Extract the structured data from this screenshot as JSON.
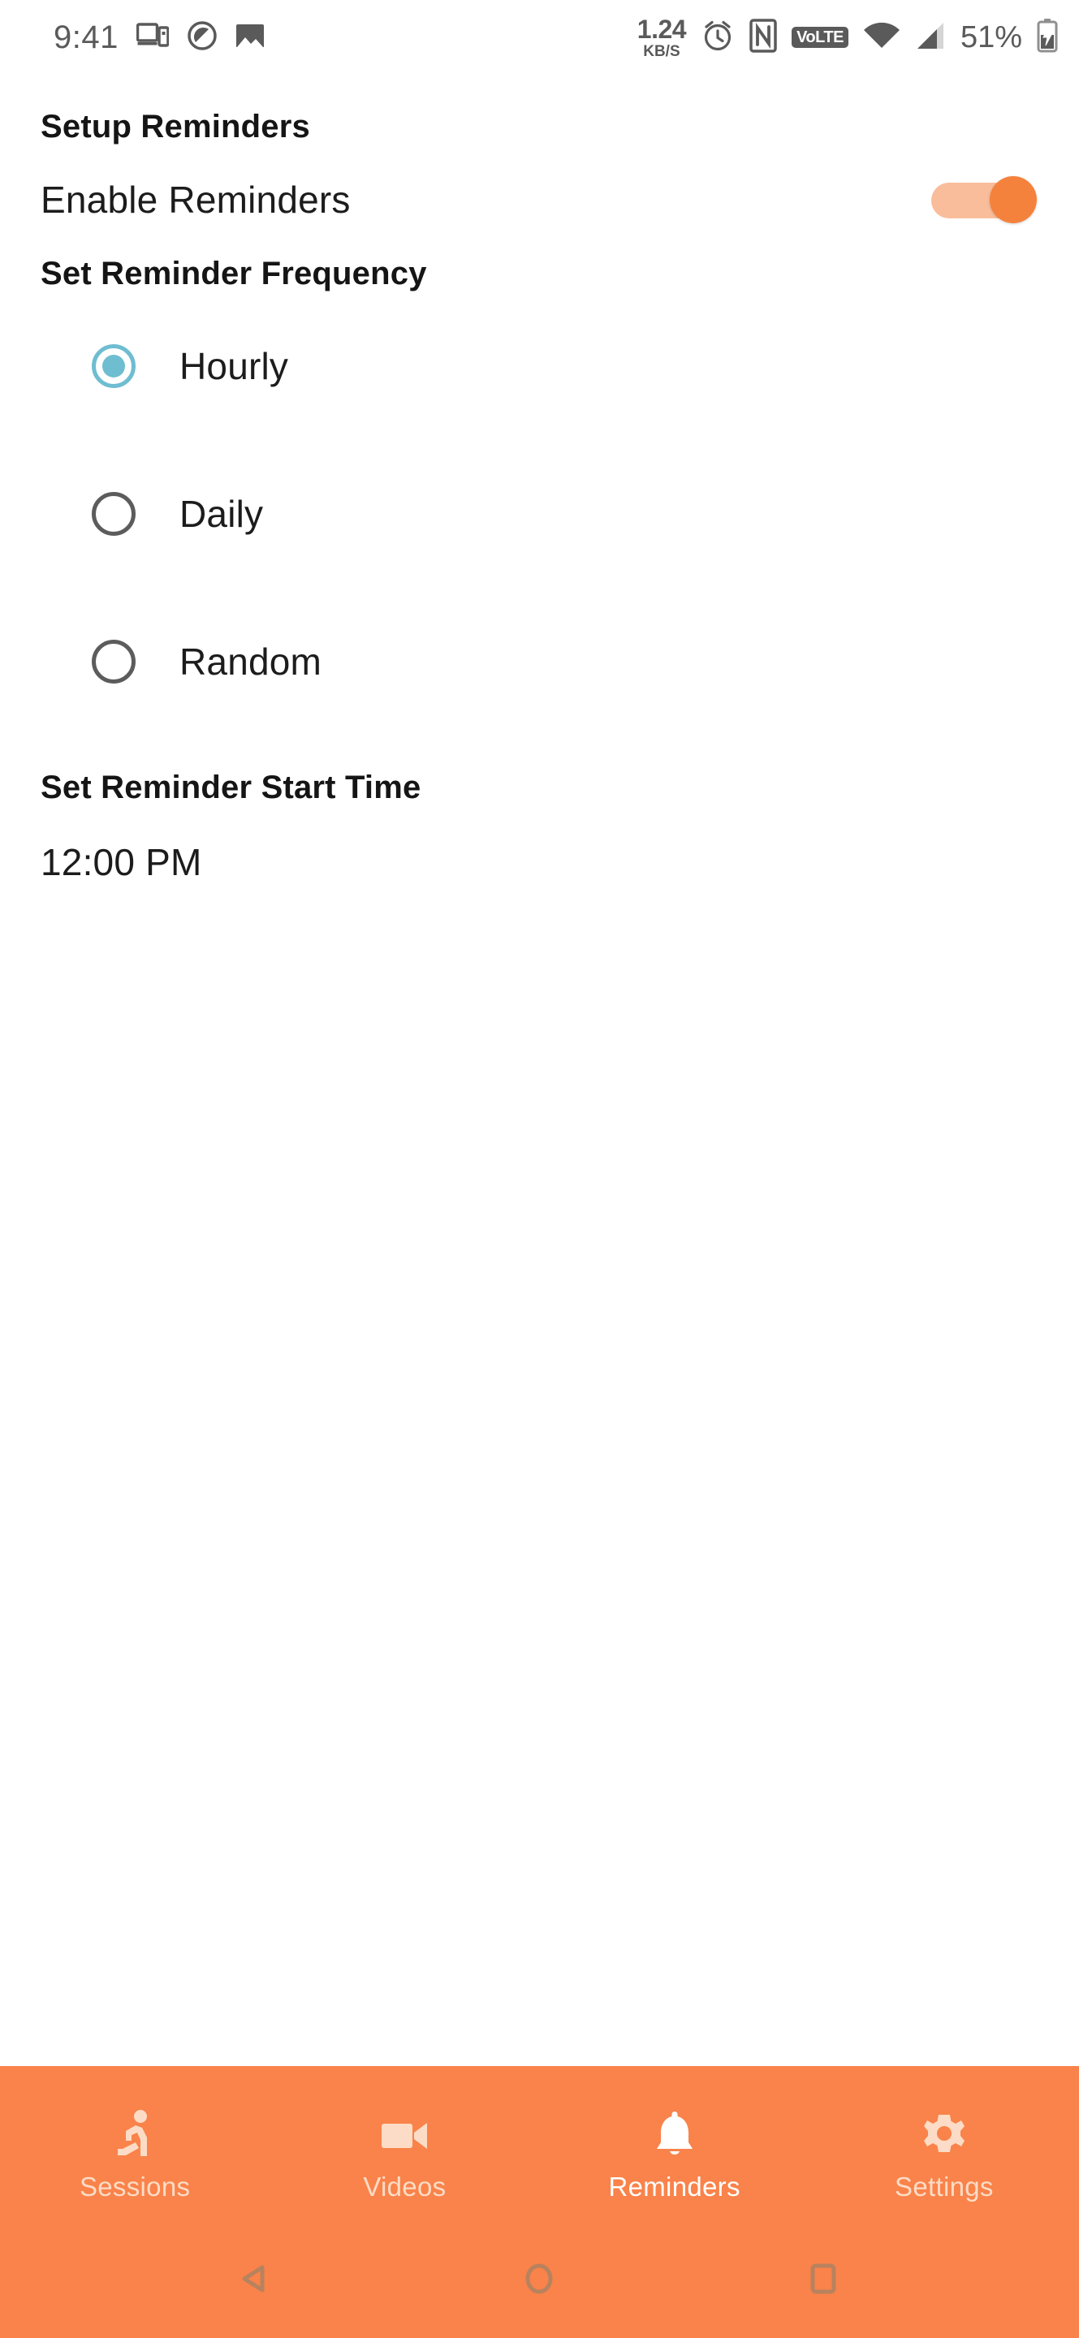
{
  "status_bar": {
    "clock": "9:41",
    "left_icons": [
      "cast-screen-icon",
      "privacy-shield-icon",
      "image-icon"
    ],
    "network_speed_value": "1.24",
    "network_speed_unit": "KB/S",
    "right_icons": [
      "alarm-clock-icon",
      "nfc-icon",
      "wifi-icon",
      "cellular-signal-icon",
      "battery-charging-icon"
    ],
    "volte_label": "VoLTE",
    "battery_percent": "51%"
  },
  "screen": {
    "title": "Setup Reminders",
    "enable_row": {
      "label": "Enable Reminders",
      "toggle_on": true
    },
    "frequency": {
      "heading": "Set Reminder Frequency",
      "selected": "Hourly",
      "options": [
        {
          "label": "Hourly",
          "selected": true
        },
        {
          "label": "Daily",
          "selected": false
        },
        {
          "label": "Random",
          "selected": false
        }
      ]
    },
    "start_time": {
      "heading": "Set Reminder Start Time",
      "value": "12:00 PM"
    }
  },
  "bottom_nav": {
    "active": "Reminders",
    "tabs": [
      {
        "label": "Sessions",
        "icon": "running-person-icon",
        "active": false
      },
      {
        "label": "Videos",
        "icon": "video-camera-icon",
        "active": false
      },
      {
        "label": "Reminders",
        "icon": "bell-icon",
        "active": true
      },
      {
        "label": "Settings",
        "icon": "gear-icon",
        "active": false
      }
    ]
  },
  "android_nav": {
    "back": "back-triangle-icon",
    "home": "home-circle-icon",
    "recents": "recents-square-icon"
  },
  "colors": {
    "accent_orange": "#f9834a",
    "toggle_thumb": "#f5823c",
    "toggle_track": "#f9bd9b",
    "radio_selected": "#6fbdd1",
    "radio_unselected": "#5c5c5c",
    "text_primary": "#1c1c1c",
    "nav_inactive": "#fcdcc6",
    "nav_active": "#ffffff"
  }
}
